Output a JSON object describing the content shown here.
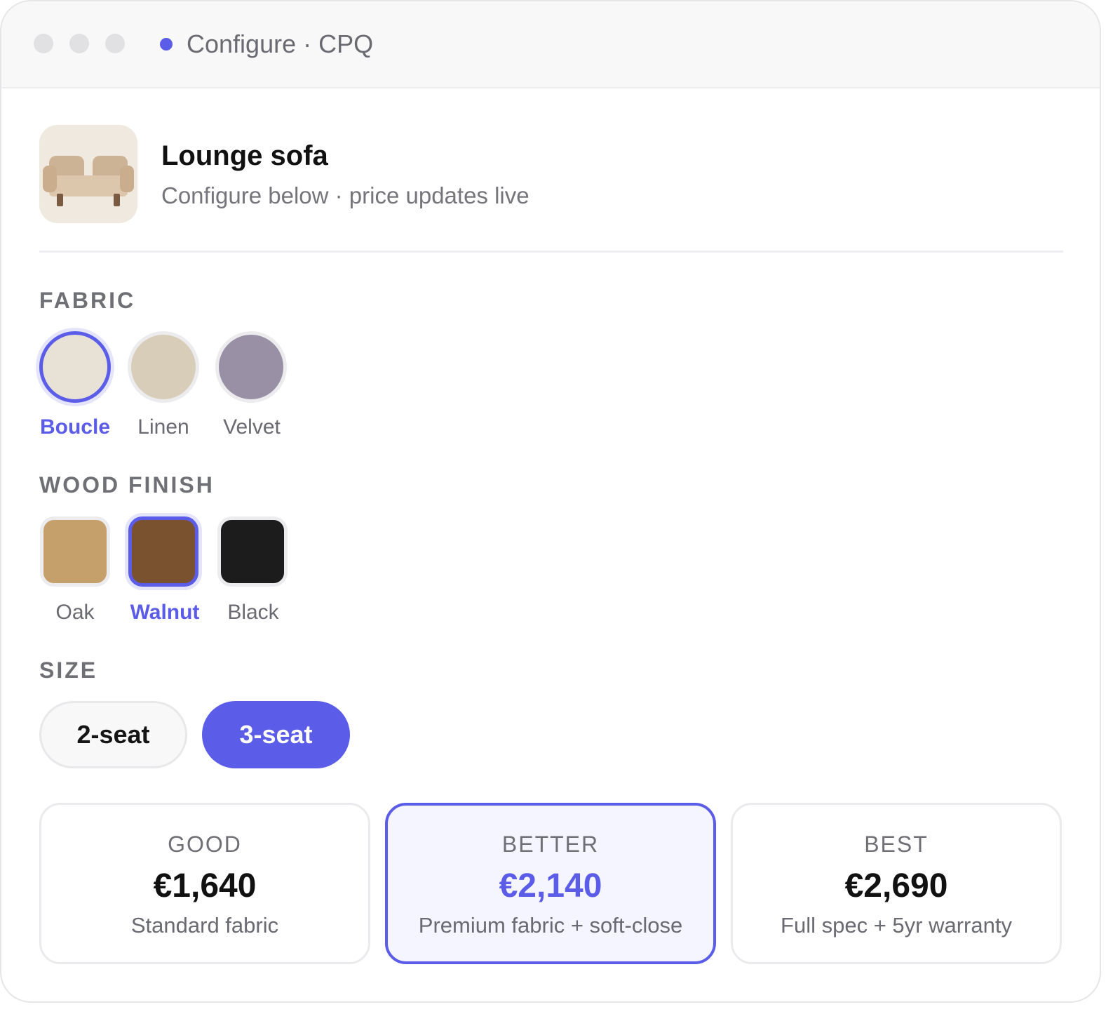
{
  "window": {
    "title": "Configure · CPQ"
  },
  "product": {
    "name": "Lounge sofa",
    "subtitle": "Configure below · price updates live",
    "thumbnail_icon": "sofa-icon"
  },
  "fabric": {
    "label": "FABRIC",
    "selected": "Boucle",
    "options": [
      {
        "label": "Boucle",
        "color": "#e8e1d6"
      },
      {
        "label": "Linen",
        "color": "#d8cdb9"
      },
      {
        "label": "Velvet",
        "color": "#9a90a6"
      }
    ]
  },
  "wood": {
    "label": "WOOD FINISH",
    "selected": "Walnut",
    "options": [
      {
        "label": "Oak",
        "color": "#c6a06b"
      },
      {
        "label": "Walnut",
        "color": "#7a5230"
      },
      {
        "label": "Black",
        "color": "#1c1c1c"
      }
    ]
  },
  "size": {
    "label": "SIZE",
    "selected": "3-seat",
    "options": [
      "2-seat",
      "3-seat"
    ]
  },
  "tiers": [
    {
      "name": "GOOD",
      "price": "€1,640",
      "desc": "Standard fabric",
      "selected": false
    },
    {
      "name": "BETTER",
      "price": "€2,140",
      "desc": "Premium fabric + soft-close",
      "selected": true
    },
    {
      "name": "BEST",
      "price": "€2,690",
      "desc": "Full spec + 5yr warranty",
      "selected": false
    }
  ],
  "colors": {
    "accent": "#5b5ce8"
  }
}
